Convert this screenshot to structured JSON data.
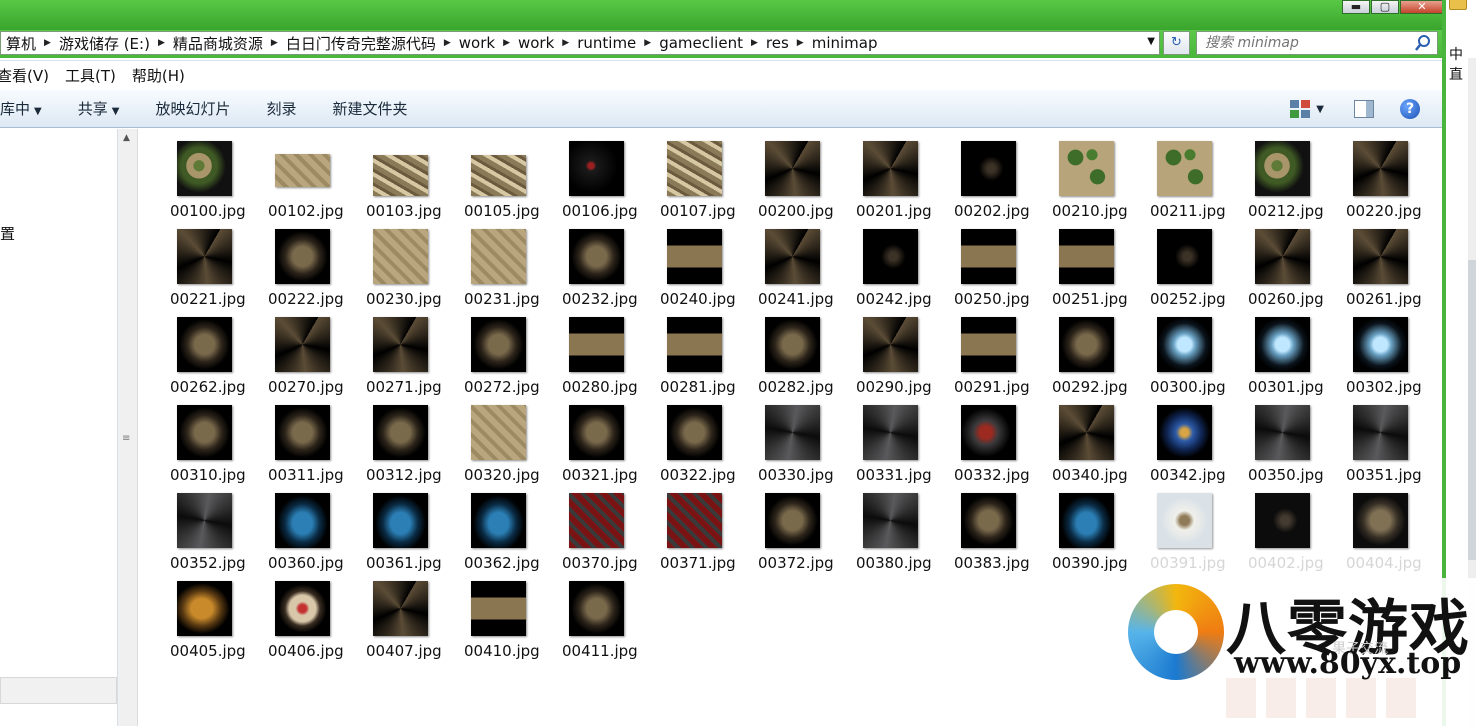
{
  "window": {
    "buttons": {
      "minimize": "▬",
      "maximize": "▢",
      "close": "✕"
    }
  },
  "address": {
    "crumbs": [
      "算机",
      "游戏储存 (E:)",
      "精品商城资源",
      "白日门传奇完整源代码",
      "work",
      "work",
      "runtime",
      "gameclient",
      "res",
      "minimap"
    ],
    "separator": "▶",
    "dropdown": "▼",
    "refresh_icon": "↻"
  },
  "search": {
    "placeholder": "搜索 minimap",
    "icon": "search-icon"
  },
  "menu": {
    "items": [
      "查看(V)",
      "工具(T)",
      "帮助(H)"
    ]
  },
  "toolbar": {
    "library_label": "库中",
    "share_label": "共享",
    "slideshow_label": "放映幻灯片",
    "burn_label": "刻录",
    "new_folder_label": "新建文件夹",
    "caret": "▼"
  },
  "nav": {
    "partial_label": "置"
  },
  "side": {
    "label": "中直"
  },
  "splitter": {
    "up_arrow": "▲",
    "grip": "≡"
  },
  "files": [
    {
      "name": "00100.jpg",
      "style": "m-grass",
      "shape": "full"
    },
    {
      "name": "00102.jpg",
      "style": "m-sand",
      "shape": "short"
    },
    {
      "name": "00103.jpg",
      "style": "m-town",
      "shape": "mid"
    },
    {
      "name": "00105.jpg",
      "style": "m-town",
      "shape": "mid"
    },
    {
      "name": "00106.jpg",
      "style": "m-red",
      "shape": "full"
    },
    {
      "name": "00107.jpg",
      "style": "m-town",
      "shape": "full"
    },
    {
      "name": "00200.jpg",
      "style": "m-cave",
      "shape": "full"
    },
    {
      "name": "00201.jpg",
      "style": "m-cave",
      "shape": "full"
    },
    {
      "name": "00202.jpg",
      "style": "m-black",
      "shape": "full"
    },
    {
      "name": "00210.jpg",
      "style": "m-forest",
      "shape": "full"
    },
    {
      "name": "00211.jpg",
      "style": "m-forest",
      "shape": "full"
    },
    {
      "name": "00212.jpg",
      "style": "m-grass",
      "shape": "full"
    },
    {
      "name": "00220.jpg",
      "style": "m-cave",
      "shape": "full"
    },
    {
      "name": "00221.jpg",
      "style": "m-cave",
      "shape": "full"
    },
    {
      "name": "00222.jpg",
      "style": "m-stone",
      "shape": "full"
    },
    {
      "name": "00230.jpg",
      "style": "m-sand",
      "shape": "full"
    },
    {
      "name": "00231.jpg",
      "style": "m-sand",
      "shape": "full"
    },
    {
      "name": "00232.jpg",
      "style": "m-stone",
      "shape": "full"
    },
    {
      "name": "00240.jpg",
      "style": "m-plus",
      "shape": "full"
    },
    {
      "name": "00241.jpg",
      "style": "m-cave",
      "shape": "full"
    },
    {
      "name": "00242.jpg",
      "style": "m-black",
      "shape": "full"
    },
    {
      "name": "00250.jpg",
      "style": "m-plus",
      "shape": "full"
    },
    {
      "name": "00251.jpg",
      "style": "m-plus",
      "shape": "full"
    },
    {
      "name": "00252.jpg",
      "style": "m-black",
      "shape": "full"
    },
    {
      "name": "00260.jpg",
      "style": "m-cave",
      "shape": "full"
    },
    {
      "name": "00261.jpg",
      "style": "m-cave",
      "shape": "full"
    },
    {
      "name": "00262.jpg",
      "style": "m-stone",
      "shape": "full"
    },
    {
      "name": "00270.jpg",
      "style": "m-cave",
      "shape": "full"
    },
    {
      "name": "00271.jpg",
      "style": "m-cave",
      "shape": "full"
    },
    {
      "name": "00272.jpg",
      "style": "m-stone",
      "shape": "full"
    },
    {
      "name": "00280.jpg",
      "style": "m-plus",
      "shape": "full"
    },
    {
      "name": "00281.jpg",
      "style": "m-plus",
      "shape": "full"
    },
    {
      "name": "00282.jpg",
      "style": "m-stone",
      "shape": "full"
    },
    {
      "name": "00290.jpg",
      "style": "m-cave",
      "shape": "full"
    },
    {
      "name": "00291.jpg",
      "style": "m-plus",
      "shape": "full"
    },
    {
      "name": "00292.jpg",
      "style": "m-stone",
      "shape": "full"
    },
    {
      "name": "00300.jpg",
      "style": "m-ice",
      "shape": "full"
    },
    {
      "name": "00301.jpg",
      "style": "m-ice",
      "shape": "full"
    },
    {
      "name": "00302.jpg",
      "style": "m-ice",
      "shape": "full"
    },
    {
      "name": "00310.jpg",
      "style": "m-stone",
      "shape": "full"
    },
    {
      "name": "00311.jpg",
      "style": "m-stone",
      "shape": "full"
    },
    {
      "name": "00312.jpg",
      "style": "m-stone",
      "shape": "full"
    },
    {
      "name": "00320.jpg",
      "style": "m-sand",
      "shape": "full"
    },
    {
      "name": "00321.jpg",
      "style": "m-stone",
      "shape": "full"
    },
    {
      "name": "00322.jpg",
      "style": "m-stone",
      "shape": "full"
    },
    {
      "name": "00330.jpg",
      "style": "m-gray",
      "shape": "full"
    },
    {
      "name": "00331.jpg",
      "style": "m-gray",
      "shape": "full"
    },
    {
      "name": "00332.jpg",
      "style": "m-lava",
      "shape": "full"
    },
    {
      "name": "00340.jpg",
      "style": "m-cave",
      "shape": "full"
    },
    {
      "name": "00342.jpg",
      "style": "m-blue",
      "shape": "full"
    },
    {
      "name": "00350.jpg",
      "style": "m-gray",
      "shape": "full"
    },
    {
      "name": "00351.jpg",
      "style": "m-gray",
      "shape": "full"
    },
    {
      "name": "00352.jpg",
      "style": "m-gray",
      "shape": "full"
    },
    {
      "name": "00360.jpg",
      "style": "m-water",
      "shape": "full"
    },
    {
      "name": "00361.jpg",
      "style": "m-water",
      "shape": "full"
    },
    {
      "name": "00362.jpg",
      "style": "m-water",
      "shape": "full"
    },
    {
      "name": "00370.jpg",
      "style": "m-blood",
      "shape": "full"
    },
    {
      "name": "00371.jpg",
      "style": "m-blood",
      "shape": "full"
    },
    {
      "name": "00372.jpg",
      "style": "m-stone",
      "shape": "full"
    },
    {
      "name": "00380.jpg",
      "style": "m-gray",
      "shape": "full"
    },
    {
      "name": "00383.jpg",
      "style": "m-stone",
      "shape": "full"
    },
    {
      "name": "00390.jpg",
      "style": "m-water",
      "shape": "full"
    },
    {
      "name": "00391.jpg",
      "style": "m-snow",
      "shape": "full",
      "faded": true
    },
    {
      "name": "00402.jpg",
      "style": "m-black",
      "shape": "full",
      "faded": true
    },
    {
      "name": "00404.jpg",
      "style": "m-stone",
      "shape": "full",
      "faded": true
    },
    {
      "name": "00405.jpg",
      "style": "m-orange",
      "shape": "full"
    },
    {
      "name": "00406.jpg",
      "style": "m-arena",
      "shape": "full"
    },
    {
      "name": "00407.jpg",
      "style": "m-cave",
      "shape": "full"
    },
    {
      "name": "00410.jpg",
      "style": "m-plus",
      "shape": "full"
    },
    {
      "name": "00411.jpg",
      "style": "m-stone",
      "shape": "full"
    }
  ],
  "watermark": {
    "brand": "八零游戏",
    "url": "www.80yx.top",
    "sub": "果子交流"
  }
}
